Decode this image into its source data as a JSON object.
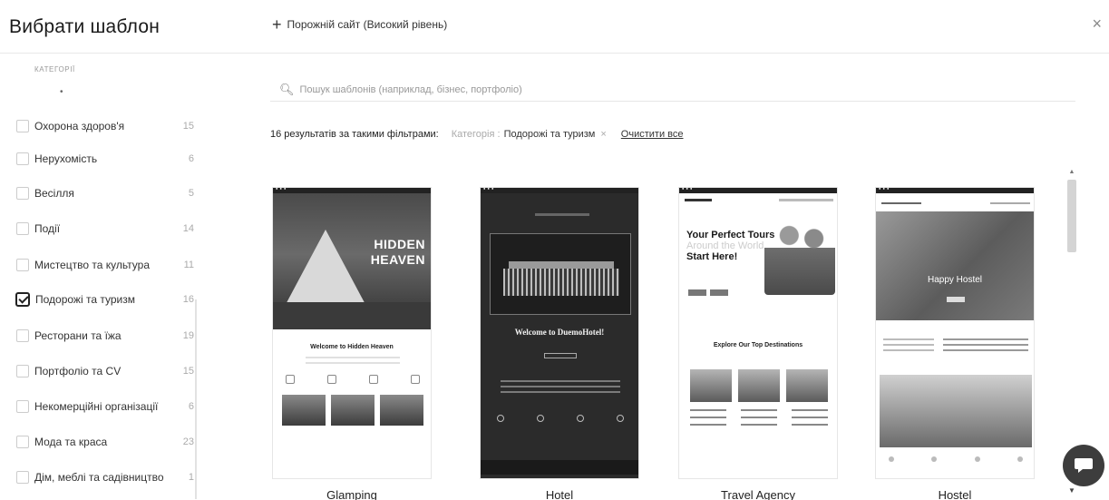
{
  "header": {
    "title": "Вибрати шаблон",
    "blank_site": "Порожній сайт (Високий рівень)",
    "plus": "+",
    "close": "×"
  },
  "sidebar": {
    "heading": "КАТЕГОРІЇ",
    "dot": "•",
    "categories": [
      {
        "label": "Охорона здоров'я",
        "count": "15",
        "checked": false
      },
      {
        "label": "Нерухомість",
        "count": "6",
        "checked": false
      },
      {
        "label": "Весілля",
        "count": "5",
        "checked": false
      },
      {
        "label": "Події",
        "count": "14",
        "checked": false
      },
      {
        "label": "Мистецтво та культура",
        "count": "11",
        "checked": false
      },
      {
        "label": "Подорожі та туризм",
        "count": "16",
        "checked": true
      },
      {
        "label": "Ресторани та їжа",
        "count": "19",
        "checked": false
      },
      {
        "label": "Портфоліо та CV",
        "count": "15",
        "checked": false
      },
      {
        "label": "Некомерційні організації",
        "count": "6",
        "checked": false
      },
      {
        "label": "Мода та краса",
        "count": "23",
        "checked": false
      },
      {
        "label": "Дім, меблі та садівництво",
        "count": "1",
        "checked": false
      }
    ]
  },
  "search": {
    "placeholder": "Пошук шаблонів (наприклад, бізнес, портфоліо)",
    "value": ""
  },
  "filters": {
    "results": "16 результатів за такими фільтрами:",
    "chip_key": "Категорія :",
    "chip_value": "Подорожі та туризм",
    "chip_remove": "×",
    "clear_all": "Очистити все"
  },
  "templates": [
    {
      "name": "Glamping",
      "headline_1": "HIDDEN",
      "headline_2": "HEAVEN",
      "welcome": "Welcome to Hidden Heaven"
    },
    {
      "name": "Hotel",
      "welcome": "Welcome to DuemoHotel!"
    },
    {
      "name": "Travel Agency",
      "headline_1": "Your Perfect Tours",
      "headline_2": "Around the World",
      "headline_3": "Start Here!",
      "explore": "Explore Our Top Destinations"
    },
    {
      "name": "Hostel",
      "hero": "Happy Hostel"
    }
  ],
  "icons": {
    "search": "search-icon",
    "close": "close-icon",
    "chat": "chat-icon",
    "scroll_up": "▲",
    "scroll_down": "▼"
  },
  "colors": {
    "chat_bubble": "#3d3d3d",
    "hotel_bg": "#2b2b2b"
  }
}
